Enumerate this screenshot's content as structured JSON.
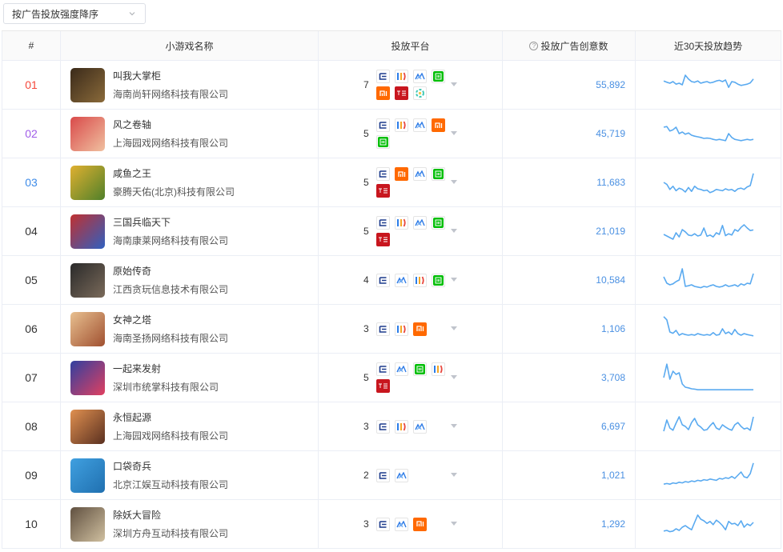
{
  "sort": {
    "label": "按广告投放强度降序"
  },
  "headers": {
    "rank": "#",
    "game": "小游戏名称",
    "platform": "投放平台",
    "count": "投放广告创意数",
    "trend": "近30天投放趋势"
  },
  "colors": {
    "trend_line": "#5aaaf0",
    "count_link": "#4a90e2",
    "rank1": "#f5483b",
    "rank2": "#a05ce8",
    "rank3": "#3d8be8"
  },
  "rows": [
    {
      "rank": "01",
      "name": "叫我大掌柜",
      "company": "海南尚轩网络科技有限公司",
      "platform_count": "7",
      "platforms": [
        "ocean-engine",
        "toutiao-channel",
        "tencent-ads",
        "iqiyi",
        "xiaomi",
        "wangyi",
        "bilibili-swirl"
      ],
      "count": "55,892",
      "trend": [
        62,
        58,
        55,
        60,
        52,
        55,
        50,
        80,
        68,
        60,
        58,
        62,
        55,
        58,
        60,
        56,
        58,
        62,
        64,
        60,
        65,
        42,
        60,
        58,
        52,
        48,
        50,
        52,
        56,
        68
      ]
    },
    {
      "rank": "02",
      "name": "风之卷轴",
      "company": "上海园戏网络科技有限公司",
      "platform_count": "5",
      "platforms": [
        "ocean-engine",
        "toutiao-channel",
        "tencent-ads",
        "xiaomi",
        "iqiyi"
      ],
      "count": "45,719",
      "trend": [
        70,
        72,
        58,
        62,
        70,
        50,
        55,
        48,
        52,
        45,
        42,
        40,
        38,
        35,
        36,
        35,
        32,
        30,
        32,
        30,
        28,
        50,
        38,
        32,
        30,
        28,
        30,
        32,
        30,
        32
      ]
    },
    {
      "rank": "03",
      "name": "咸鱼之王",
      "company": "豪腾天佑(北京)科技有限公司",
      "platform_count": "5",
      "platforms": [
        "ocean-engine",
        "xiaomi",
        "tencent-ads",
        "iqiyi",
        "wangyi"
      ],
      "count": "11,683",
      "trend": [
        50,
        44,
        28,
        38,
        24,
        32,
        28,
        20,
        34,
        22,
        38,
        30,
        28,
        24,
        26,
        18,
        22,
        28,
        26,
        24,
        30,
        26,
        28,
        22,
        30,
        32,
        28,
        36,
        40,
        78
      ]
    },
    {
      "rank": "04",
      "name": "三国兵临天下",
      "company": "海南康莱网络科技有限公司",
      "platform_count": "5",
      "platforms": [
        "ocean-engine",
        "toutiao-channel",
        "tencent-ads",
        "iqiyi",
        "wangyi"
      ],
      "count": "21,019",
      "trend": [
        40,
        35,
        30,
        25,
        45,
        32,
        55,
        48,
        38,
        36,
        42,
        35,
        38,
        60,
        34,
        38,
        32,
        45,
        40,
        68,
        36,
        42,
        38,
        55,
        50,
        62,
        70,
        60,
        52,
        54
      ]
    },
    {
      "rank": "05",
      "name": "原始传奇",
      "company": "江西贪玩信息技术有限公司",
      "platform_count": "4",
      "platforms": [
        "ocean-engine",
        "tencent-ads",
        "toutiao-channel",
        "iqiyi"
      ],
      "count": "10,584",
      "trend": [
        60,
        40,
        35,
        38,
        45,
        50,
        85,
        30,
        32,
        35,
        30,
        28,
        26,
        30,
        28,
        32,
        35,
        30,
        28,
        30,
        35,
        30,
        32,
        35,
        30,
        38,
        34,
        40,
        38,
        70
      ]
    },
    {
      "rank": "06",
      "name": "女神之塔",
      "company": "海南圣扬网络科技有限公司",
      "platform_count": "3",
      "platforms": [
        "ocean-engine",
        "toutiao-channel",
        "xiaomi"
      ],
      "count": "1,106",
      "trend": [
        88,
        78,
        40,
        36,
        45,
        30,
        35,
        32,
        30,
        32,
        30,
        35,
        32,
        30,
        32,
        30,
        38,
        30,
        32,
        50,
        35,
        40,
        32,
        48,
        35,
        30,
        35,
        32,
        30,
        28
      ]
    },
    {
      "rank": "07",
      "name": "一起来发射",
      "company": "深圳市统掌科技有限公司",
      "platform_count": "5",
      "platforms": [
        "ocean-engine",
        "tencent-ads",
        "iqiyi",
        "toutiao-channel",
        "wangyi"
      ],
      "count": "3,708",
      "trend": [
        50,
        92,
        45,
        70,
        60,
        65,
        30,
        20,
        18,
        15,
        14,
        12,
        12,
        12,
        12,
        12,
        12,
        12,
        12,
        12,
        12,
        12,
        12,
        12,
        12,
        12,
        12,
        12,
        12,
        12
      ]
    },
    {
      "rank": "08",
      "name": "永恒起源",
      "company": "上海园戏网络科技有限公司",
      "platform_count": "3",
      "platforms": [
        "ocean-engine",
        "toutiao-channel",
        "tencent-ads"
      ],
      "count": "6,697",
      "trend": [
        35,
        70,
        45,
        38,
        60,
        80,
        55,
        50,
        40,
        62,
        75,
        55,
        48,
        38,
        40,
        52,
        62,
        45,
        40,
        55,
        48,
        42,
        38,
        55,
        62,
        50,
        42,
        45,
        38,
        80
      ]
    },
    {
      "rank": "09",
      "name": "口袋奇兵",
      "company": "北京江娱互动科技有限公司",
      "platform_count": "2",
      "platforms": [
        "ocean-engine",
        "tencent-ads"
      ],
      "count": "1,021",
      "trend": [
        22,
        24,
        22,
        26,
        24,
        28,
        26,
        30,
        28,
        32,
        30,
        34,
        32,
        36,
        34,
        38,
        36,
        34,
        40,
        38,
        42,
        40,
        46,
        40,
        50,
        60,
        45,
        42,
        55,
        88
      ]
    },
    {
      "rank": "10",
      "name": "除妖大冒险",
      "company": "深圳方舟互动科技有限公司",
      "platform_count": "3",
      "platforms": [
        "ocean-engine",
        "tencent-ads",
        "xiaomi"
      ],
      "count": "1,292",
      "trend": [
        28,
        30,
        26,
        28,
        35,
        30,
        40,
        45,
        38,
        32,
        55,
        78,
        65,
        60,
        52,
        58,
        48,
        62,
        55,
        45,
        32,
        58,
        50,
        52,
        45,
        60,
        40,
        50,
        45,
        55
      ]
    }
  ]
}
